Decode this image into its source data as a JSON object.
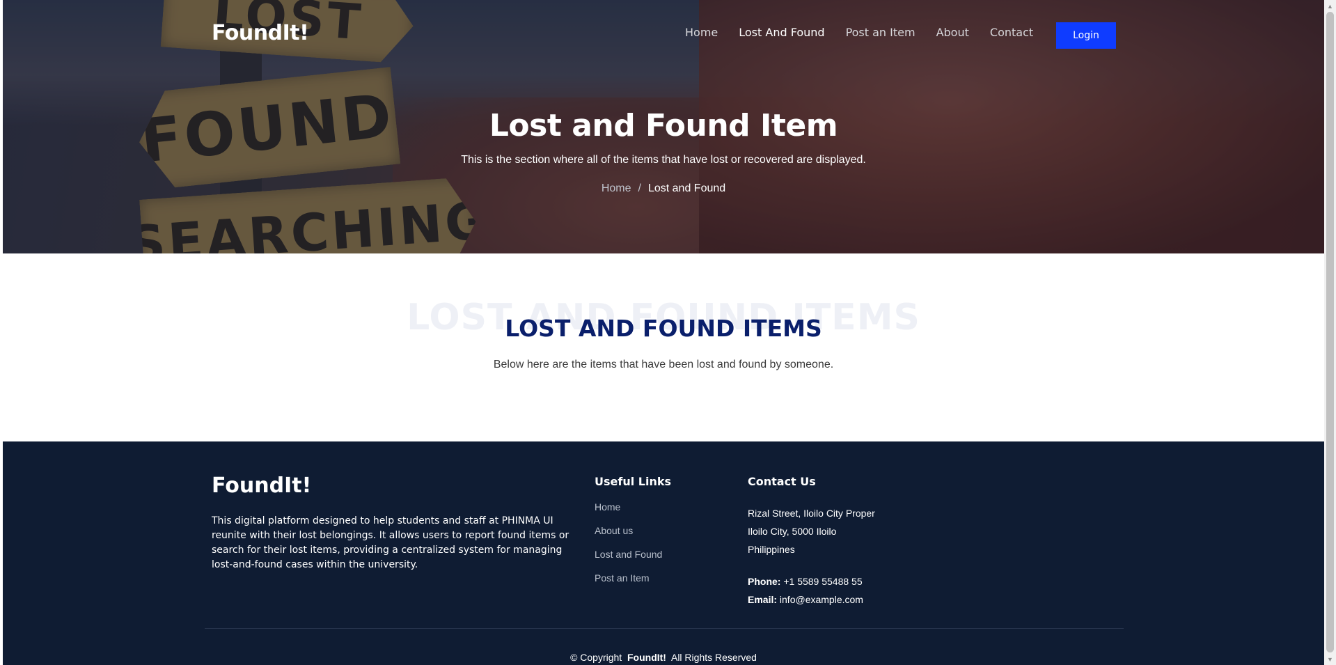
{
  "brand": "FoundIt!",
  "nav": {
    "items": [
      {
        "label": "Home",
        "active": false
      },
      {
        "label": "Lost And Found",
        "active": true
      },
      {
        "label": "Post an Item",
        "active": false
      },
      {
        "label": "About",
        "active": false
      },
      {
        "label": "Contact",
        "active": false
      }
    ],
    "login_label": "Login"
  },
  "hero": {
    "sign_words": [
      "LOST",
      "FOUND",
      "SEARCHING"
    ],
    "title": "Lost and Found Item",
    "subtitle": "This is the section where all of the items that have lost or recovered are displayed.",
    "breadcrumb": {
      "home": "Home",
      "separator": "/",
      "current": "Lost and Found"
    }
  },
  "section": {
    "ghost_title": "LOST AND FOUND ITEMS",
    "title": "LOST AND FOUND ITEMS",
    "description": "Below here are the items that have been lost and found by someone."
  },
  "footer": {
    "logo": "FoundIt!",
    "about": "This digital platform designed to help students and staff at PHINMA UI reunite with their lost belongings. It allows users to report found items or search for their lost items, providing a centralized system for managing lost-and-found cases within the university.",
    "links_title": "Useful Links",
    "links": [
      "Home",
      "About us",
      "Lost and Found",
      "Post an Item"
    ],
    "contact_title": "Contact Us",
    "address_lines": [
      "Rizal Street, Iloilo City Proper",
      "Iloilo City, 5000 Iloilo",
      "Philippines"
    ],
    "phone_label": "Phone:",
    "phone": "+1 5589 55488 55",
    "email_label": "Email:",
    "email": "info@example.com",
    "copyright_prefix": "© Copyright",
    "copyright_brand": "FoundIt!",
    "copyright_suffix": "All Rights Reserved"
  },
  "colors": {
    "accent": "#0f3cff",
    "footer_bg": "#0f1c33",
    "section_title": "#0a1f6b"
  }
}
